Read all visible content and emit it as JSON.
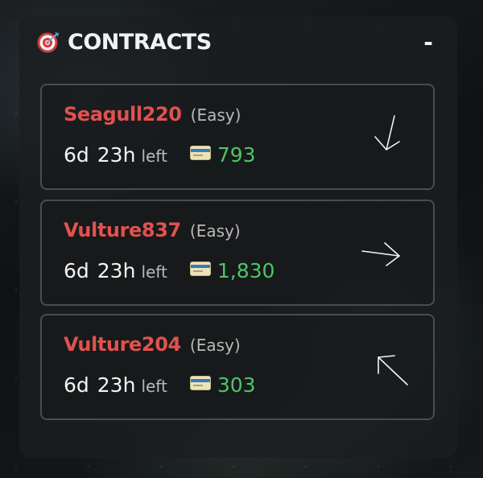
{
  "panel": {
    "title": "CONTRACTS",
    "collapse_label": "-",
    "icon": "target-icon"
  },
  "contracts": [
    {
      "name": "Seagull220",
      "difficulty": "(Easy)",
      "time_days": "6d",
      "time_hours": "23h",
      "time_suffix": "left",
      "reward": "793",
      "reward_icon": "credit-card-icon",
      "direction": "arrow-down-icon"
    },
    {
      "name": "Vulture837",
      "difficulty": "(Easy)",
      "time_days": "6d",
      "time_hours": "23h",
      "time_suffix": "left",
      "reward": "1,830",
      "reward_icon": "credit-card-icon",
      "direction": "arrow-right-icon"
    },
    {
      "name": "Vulture204",
      "difficulty": "(Easy)",
      "time_days": "6d",
      "time_hours": "23h",
      "time_suffix": "left",
      "reward": "303",
      "reward_icon": "credit-card-icon",
      "direction": "arrow-up-left-icon"
    }
  ],
  "colors": {
    "name": "#e0524f",
    "reward": "#4fc466",
    "title": "#f2f2f2",
    "muted": "#b9b9b9"
  }
}
